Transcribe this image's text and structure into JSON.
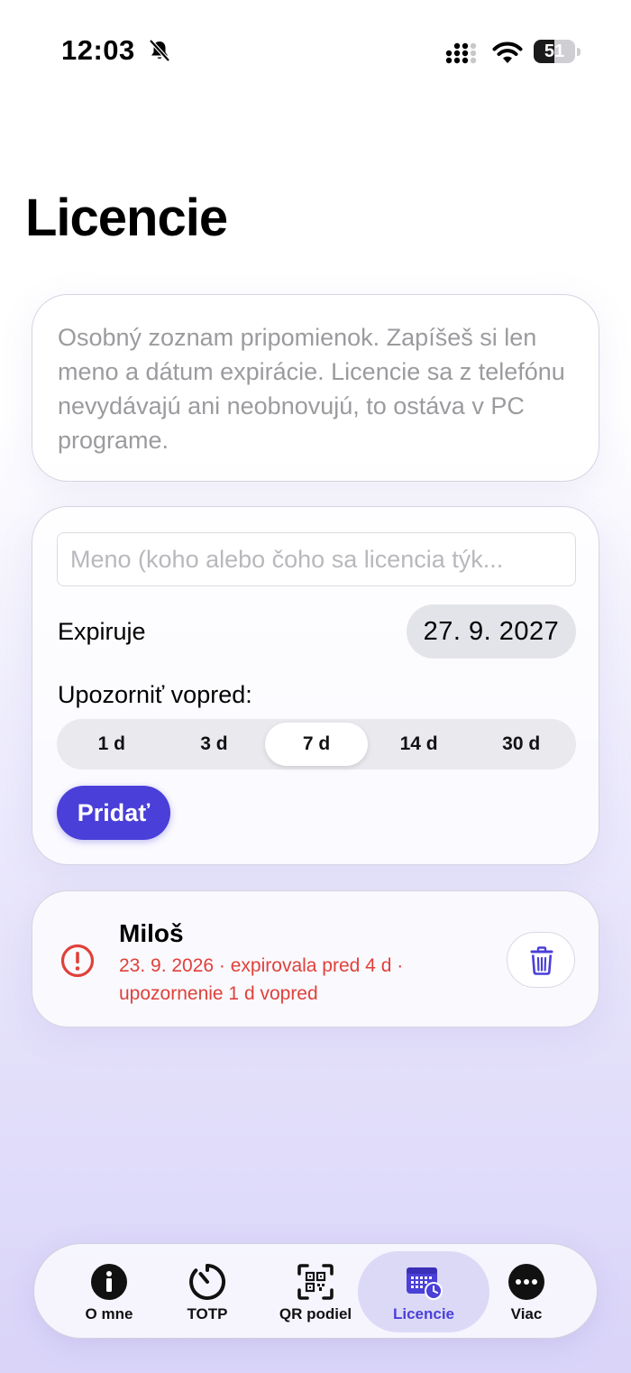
{
  "status_bar": {
    "time": "12:03",
    "battery": "51",
    "battery_level": 0.51
  },
  "page": {
    "title": "Licencie"
  },
  "info": {
    "text": "Osobný zoznam pripomienok. Zapíšeš si len meno a dátum expirácie. Licencie sa z telefónu nevydávajú ani neobnovujú, to ostáva v PC programe."
  },
  "form": {
    "name_value": "",
    "name_placeholder": "Meno (koho alebo čoho sa licencia týk...",
    "expire_label": "Expiruje",
    "expire_date": "27. 9. 2027",
    "notify_label": "Upozorniť vopred:",
    "notify_options": [
      "1 d",
      "3 d",
      "7 d",
      "14 d",
      "30 d"
    ],
    "notify_selected": "7 d",
    "add_label": "Pridať"
  },
  "licenses": [
    {
      "name": "Miloš",
      "detail": "23. 9. 2026 · expirovala pred 4 d · upozornenie 1 d vopred",
      "status": "expired",
      "status_color": "#e0403a"
    }
  ],
  "tabs": [
    {
      "label": "O mne",
      "icon": "info-icon"
    },
    {
      "label": "TOTP",
      "icon": "timer-icon"
    },
    {
      "label": "QR podiel",
      "icon": "qr-scan-icon"
    },
    {
      "label": "Licencie",
      "icon": "calendar-clock-icon",
      "active": true
    },
    {
      "label": "Viac",
      "icon": "more-icon"
    }
  ],
  "colors": {
    "accent": "#4a3fd8",
    "danger": "#e0403a"
  }
}
